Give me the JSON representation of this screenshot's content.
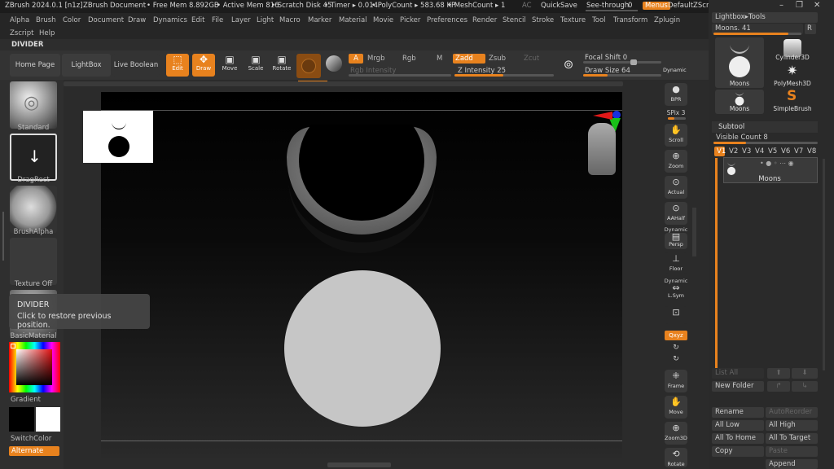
{
  "titlebar": {
    "app": "ZBrush 2024.0.1 [n1z]",
    "document": "ZBrush Document",
    "free_mem": "• Free Mem 8.892GB",
    "active_mem": "• Active Mem 816",
    "scratch": "• Scratch Disk 45",
    "timer": "• Timer ▸ 0.014",
    "polycount": "• PolyCount ▸ 583.68 KP",
    "meshcount": "• MeshCount ▸ 1",
    "ac": "AC",
    "quicksave": "QuickSave",
    "see_through": "See-through",
    "see_through_value": "0",
    "menus": "Menus",
    "zscript": "DefaultZScript"
  },
  "menus": {
    "row1": [
      "Alpha",
      "Brush",
      "Color",
      "Document",
      "Draw",
      "Dynamics",
      "Edit",
      "File",
      "Layer",
      "Light",
      "Macro",
      "Marker",
      "Material",
      "Movie",
      "Picker",
      "Preferences",
      "Render",
      "Stencil",
      "Stroke",
      "Texture",
      "Tool",
      "Transform",
      "Zplugin"
    ],
    "row2": [
      "Zscript",
      "Help"
    ]
  },
  "divider_label": "DIVIDER",
  "shelf": {
    "home": "Home Page",
    "lightbox": "LightBox",
    "live_boolean": "Live Boolean",
    "edit": "Edit",
    "draw": "Draw",
    "move": "Move",
    "scale": "Scale",
    "rotate": "Rotate",
    "a": "A",
    "mrgb": "Mrgb",
    "rgb": "Rgb",
    "m": "M",
    "rgb_intensity": "Rgb Intensity",
    "zadd": "Zadd",
    "zsub": "Zsub",
    "zcut": "Zcut",
    "z_intensity": "Z Intensity 25",
    "focal_shift": "Focal Shift 0",
    "draw_size": "Draw Size 64",
    "dynamic": "Dynamic"
  },
  "left": {
    "standard": "Standard",
    "dragrect": "DragRect",
    "brushalpha": "BrushAlpha",
    "texture_off": "Texture Off",
    "basic_material": "BasicMaterial",
    "gradient": "Gradient",
    "switch_color": "SwitchColor",
    "alternate": "Alternate"
  },
  "tooltip": {
    "title": "DIVIDER",
    "text": "Click to restore previous position."
  },
  "rightshelf": {
    "bpr": "BPR",
    "spix": "SPix 3",
    "scroll": "Scroll",
    "zoom": "Zoom",
    "actual": "Actual",
    "aahalf": "AAHalf",
    "dynamic": "Dynamic",
    "persp": "Persp",
    "floor": "Floor",
    "dynamic2": "Dynamic",
    "lsym": "L.Sym",
    "qxyz": "Qxyz",
    "frame": "Frame",
    "move": "Move",
    "zoom3d": "Zoom3D",
    "rotate": "Rotate"
  },
  "rightpanel": {
    "lightbox_tools": "Lightbox▸Tools",
    "moons_slider": "Moons. 41",
    "r": "R",
    "moons": "Moons",
    "cylinder3d": "Cylinder3D",
    "polymesh3d": "PolyMesh3D",
    "moons2": "Moons",
    "simplebrush": "SimpleBrush",
    "subtool": "Subtool",
    "visible_count": "Visible Count 8",
    "versions": [
      "V1",
      "V2",
      "V3",
      "V4",
      "V5",
      "V6",
      "V7",
      "V8"
    ],
    "subtool_name": "Moons",
    "list_all": "List All",
    "new_folder": "New Folder",
    "rename": "Rename",
    "autoreorder": "AutoReorder",
    "all_low": "All Low",
    "all_high": "All High",
    "all_to_home": "All To Home",
    "all_to_target": "All To Target",
    "copy": "Copy",
    "paste": "Paste",
    "append": "Append"
  }
}
